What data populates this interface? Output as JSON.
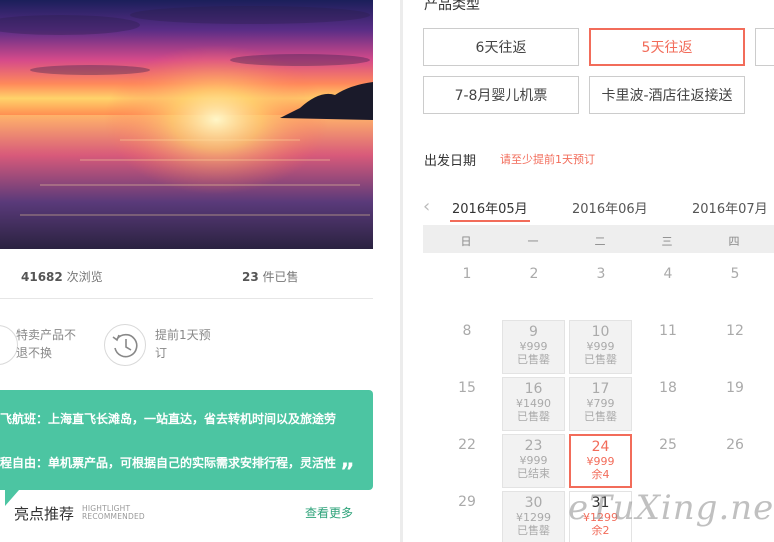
{
  "left": {
    "stats": {
      "views_count": "41682",
      "views_label": "次浏览",
      "sold_count": "23",
      "sold_label": "件已售"
    },
    "guarantees": [
      {
        "icon": "refund-icon",
        "text": "特卖产品不退不换"
      },
      {
        "icon": "clock-history-icon",
        "text": "提前1天预订"
      }
    ],
    "promo": {
      "line1": "飞航班：上海直飞长滩岛，一站直达，省去转机时间以及旅途劳",
      "line2": "程自由：单机票产品，可根据自己的实际需求安排行程，灵活性",
      "quote": "„"
    },
    "highlight": {
      "title": "亮点推荐",
      "en_line1": "HIGHTLIGHT",
      "en_line2": "RECOMMENDED",
      "more": "查看更多"
    }
  },
  "right": {
    "product_type_title": "产品类型",
    "options": [
      {
        "label": "6天往返",
        "selected": false
      },
      {
        "label": "5天往返",
        "selected": true
      },
      {
        "label": "7-8月婴儿机票",
        "selected": false
      },
      {
        "label": "卡里波-酒店往返接送",
        "selected": false
      }
    ],
    "date_title": "出发日期",
    "date_hint": "请至少提前1天预订",
    "months": [
      "2016年05月",
      "2016年06月",
      "2016年07月"
    ],
    "weekdays": [
      "日",
      "一",
      "二",
      "三",
      "四"
    ],
    "days_plain": [
      "1",
      "2",
      "3",
      "4",
      "5",
      "8",
      "11",
      "12",
      "15",
      "18",
      "19",
      "22",
      "25",
      "26",
      "29"
    ],
    "cells": {
      "d9": {
        "day": "9",
        "price": "¥999",
        "status": "已售罄"
      },
      "d10": {
        "day": "10",
        "price": "¥999",
        "status": "已售罄"
      },
      "d16": {
        "day": "16",
        "price": "¥1490",
        "status": "已售罄"
      },
      "d17": {
        "day": "17",
        "price": "¥799",
        "status": "已售罄"
      },
      "d23": {
        "day": "23",
        "price": "¥999",
        "status": "已结束"
      },
      "d24": {
        "day": "24",
        "price": "¥999",
        "status": "余4"
      },
      "d30": {
        "day": "30",
        "price": "¥1299",
        "status": "已售罄"
      },
      "d31": {
        "day": "31",
        "price": "¥1299",
        "status": "余2"
      }
    }
  },
  "watermark": "eTuXing.net",
  "colors": {
    "accent": "#f26c5a",
    "green": "#4cc5a2"
  }
}
